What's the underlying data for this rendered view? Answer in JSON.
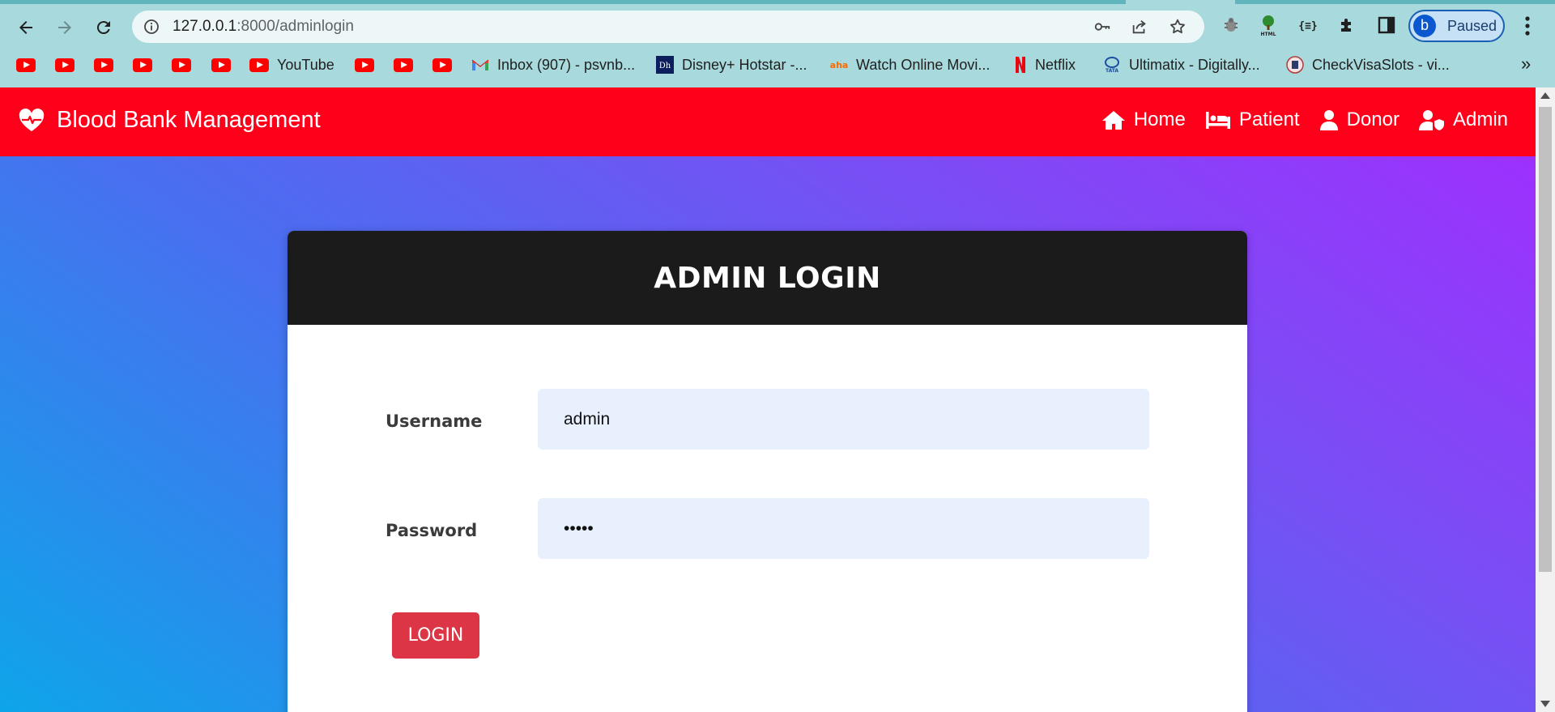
{
  "browser": {
    "url_host": "127.0.0.1",
    "url_path": ":8000/adminlogin",
    "profile_initial": "b",
    "profile_status": "Paused",
    "bookmarks": [
      {
        "icon": "youtube-icon",
        "label": ""
      },
      {
        "icon": "youtube-icon",
        "label": ""
      },
      {
        "icon": "youtube-icon",
        "label": ""
      },
      {
        "icon": "youtube-icon",
        "label": ""
      },
      {
        "icon": "youtube-icon",
        "label": ""
      },
      {
        "icon": "youtube-icon",
        "label": ""
      },
      {
        "icon": "youtube-icon",
        "label": "YouTube"
      },
      {
        "icon": "youtube-icon",
        "label": ""
      },
      {
        "icon": "youtube-icon",
        "label": ""
      },
      {
        "icon": "youtube-icon",
        "label": ""
      },
      {
        "icon": "gmail-icon",
        "label": "Inbox (907) - psvnb..."
      },
      {
        "icon": "hotstar-icon",
        "label": "Disney+ Hotstar -..."
      },
      {
        "icon": "aha-icon",
        "label": "Watch Online Movi..."
      },
      {
        "icon": "netflix-icon",
        "label": "Netflix"
      },
      {
        "icon": "tata-icon",
        "label": "Ultimatix - Digitally..."
      },
      {
        "icon": "checkvisa-icon",
        "label": "CheckVisaSlots - vi..."
      }
    ],
    "more_bookmarks": "»"
  },
  "header": {
    "brand": "Blood Bank Management",
    "nav": {
      "home": "Home",
      "patient": "Patient",
      "donor": "Donor",
      "admin": "Admin"
    }
  },
  "login": {
    "title": "ADMIN LOGIN",
    "username_label": "Username",
    "username_value": "admin",
    "password_label": "Password",
    "password_value": "•••••",
    "button": "LOGIN"
  },
  "colors": {
    "header_bg": "#ff001a",
    "card_header_bg": "#1b1b1b",
    "button_bg": "#dc3545",
    "input_bg": "#e8f0fe",
    "gradient_start": "#0ea5e9",
    "gradient_end": "#a22cff"
  }
}
